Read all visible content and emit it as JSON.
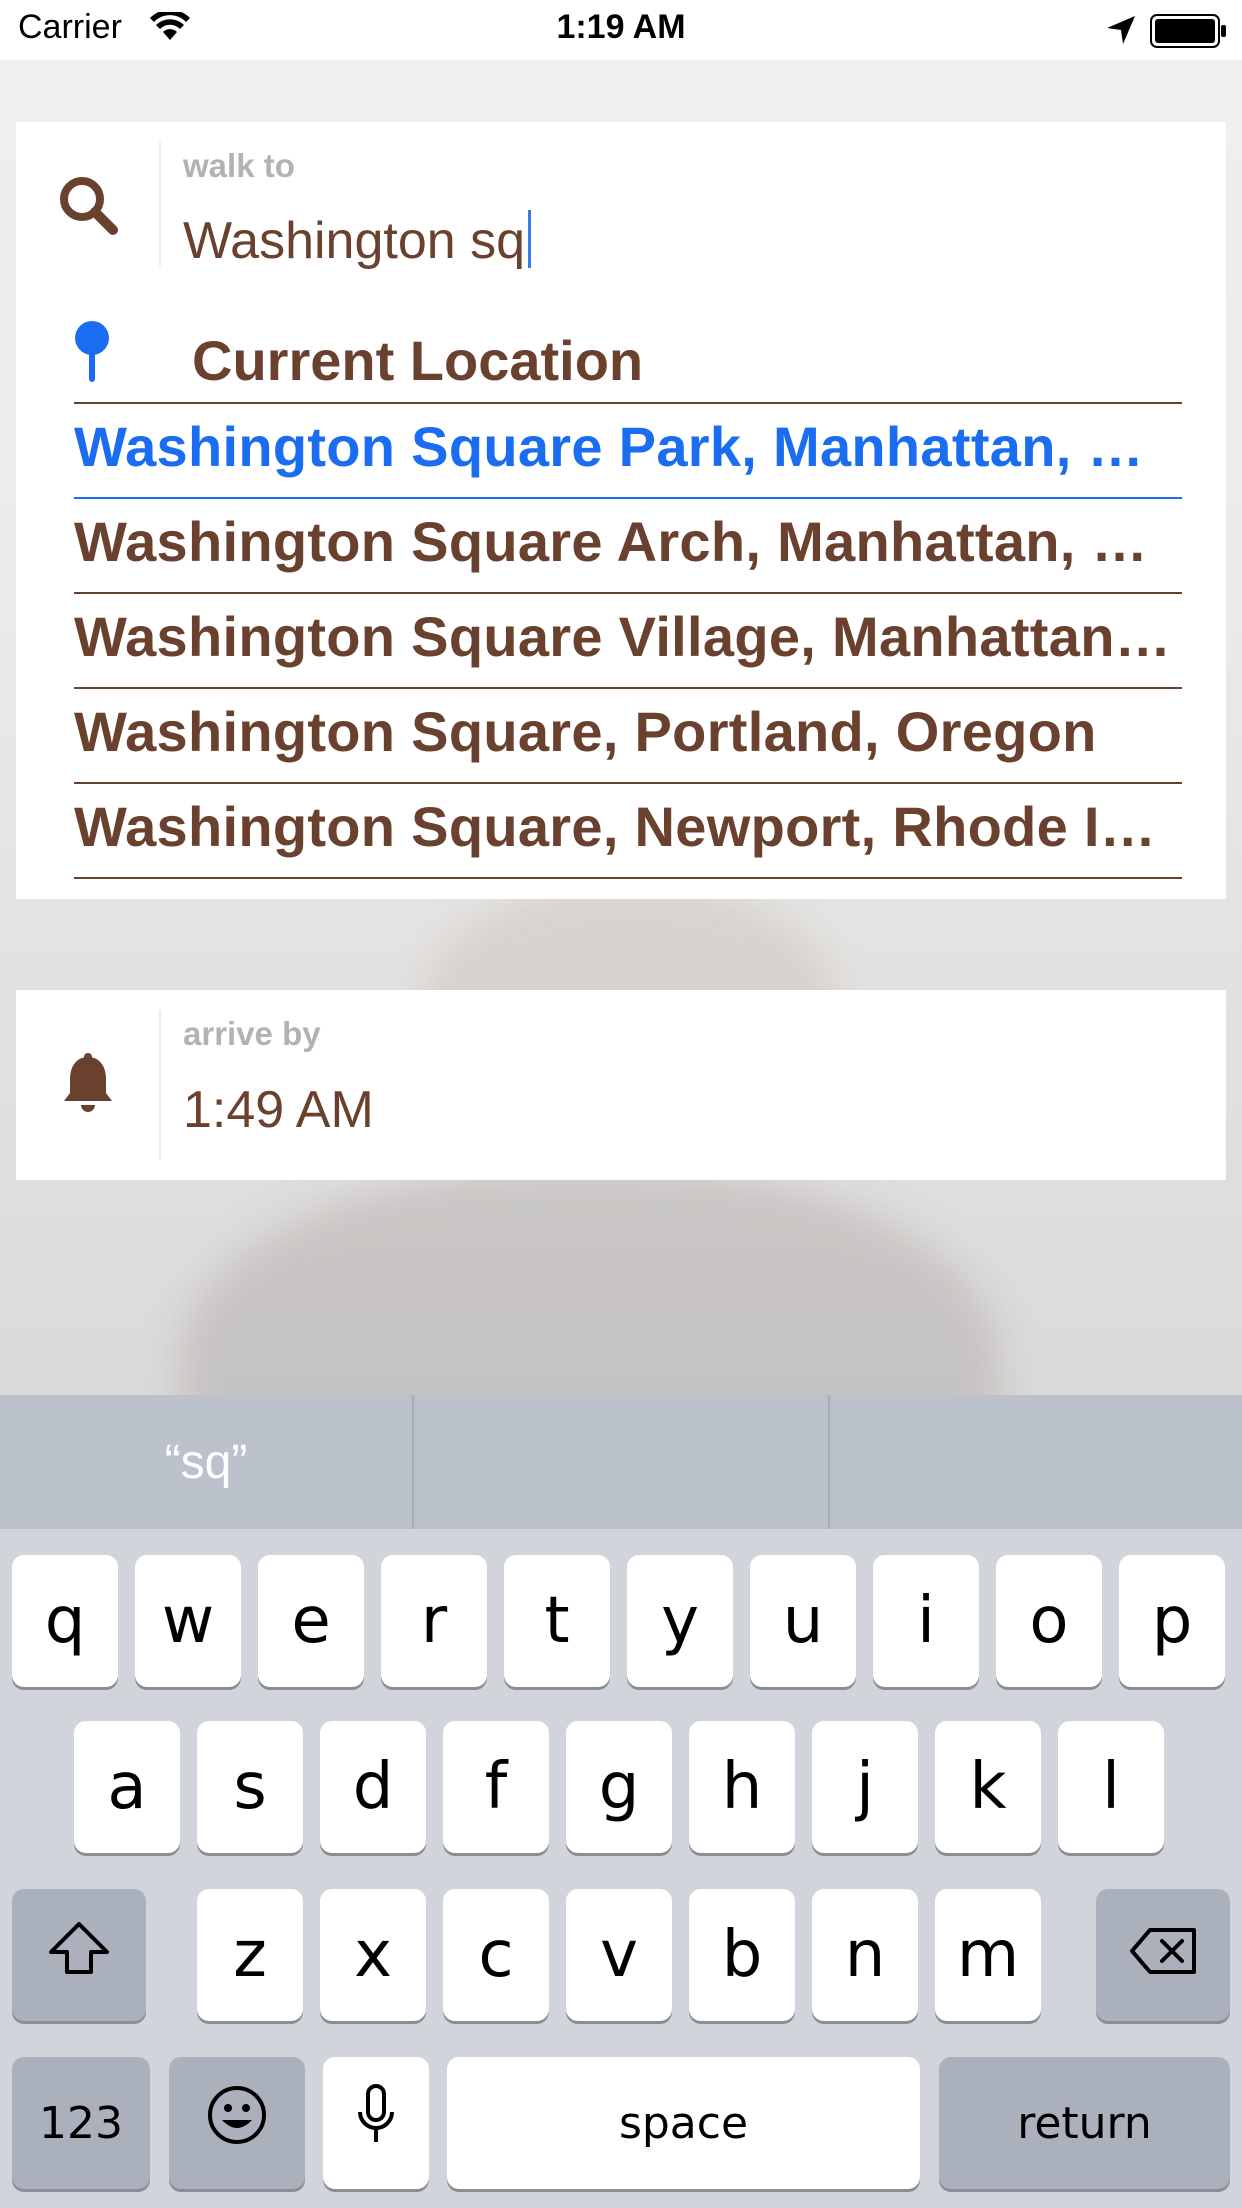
{
  "status_bar": {
    "carrier": "Carrier",
    "time": "1:19 AM"
  },
  "search": {
    "label": "walk to",
    "value": "Washington sq",
    "icon": "search-icon",
    "current_location": "Current Location",
    "suggestions": [
      "Washington Square Park, Manhattan, New York",
      "Washington Square Arch, Manhattan, New York",
      "Washington Square Village, Manhattan, New York",
      "Washington Square, Portland, Oregon",
      "Washington Square, Newport, Rhode Island"
    ],
    "active_index": 0
  },
  "arrive": {
    "label": "arrive by",
    "value": "1:49 AM",
    "icon": "bell-icon"
  },
  "keyboard": {
    "prediction": "“sq”",
    "row1": [
      "q",
      "w",
      "e",
      "r",
      "t",
      "y",
      "u",
      "i",
      "o",
      "p"
    ],
    "row2": [
      "a",
      "s",
      "d",
      "f",
      "g",
      "h",
      "j",
      "k",
      "l"
    ],
    "row3": [
      "z",
      "x",
      "c",
      "v",
      "b",
      "n",
      "m"
    ],
    "numbers_label": "123",
    "space_label": "space",
    "return_label": "return"
  },
  "colors": {
    "brown": "#6a412e",
    "blue": "#1a6cf0"
  }
}
